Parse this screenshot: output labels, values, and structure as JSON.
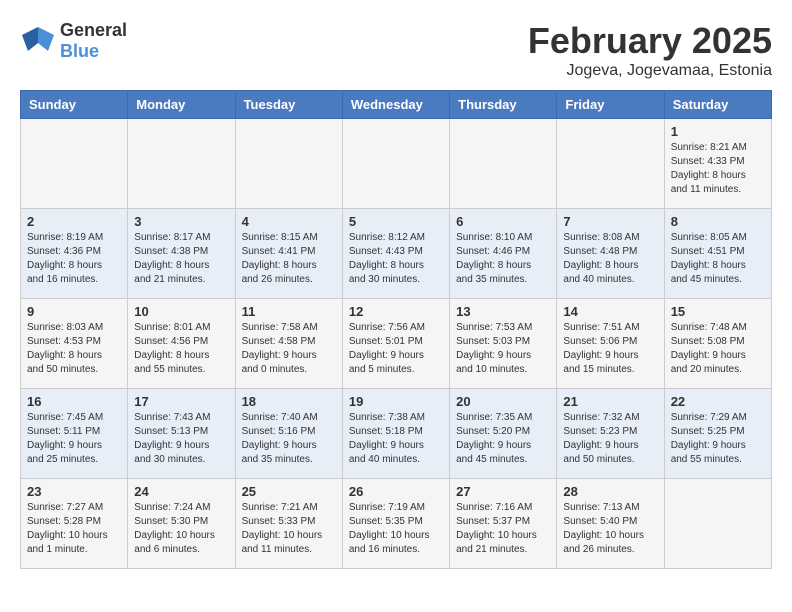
{
  "logo": {
    "general": "General",
    "blue": "Blue"
  },
  "title": "February 2025",
  "subtitle": "Jogeva, Jogevamaa, Estonia",
  "weekdays": [
    "Sunday",
    "Monday",
    "Tuesday",
    "Wednesday",
    "Thursday",
    "Friday",
    "Saturday"
  ],
  "weeks": [
    [
      {
        "day": "",
        "info": ""
      },
      {
        "day": "",
        "info": ""
      },
      {
        "day": "",
        "info": ""
      },
      {
        "day": "",
        "info": ""
      },
      {
        "day": "",
        "info": ""
      },
      {
        "day": "",
        "info": ""
      },
      {
        "day": "1",
        "info": "Sunrise: 8:21 AM\nSunset: 4:33 PM\nDaylight: 8 hours and 11 minutes."
      }
    ],
    [
      {
        "day": "2",
        "info": "Sunrise: 8:19 AM\nSunset: 4:36 PM\nDaylight: 8 hours and 16 minutes."
      },
      {
        "day": "3",
        "info": "Sunrise: 8:17 AM\nSunset: 4:38 PM\nDaylight: 8 hours and 21 minutes."
      },
      {
        "day": "4",
        "info": "Sunrise: 8:15 AM\nSunset: 4:41 PM\nDaylight: 8 hours and 26 minutes."
      },
      {
        "day": "5",
        "info": "Sunrise: 8:12 AM\nSunset: 4:43 PM\nDaylight: 8 hours and 30 minutes."
      },
      {
        "day": "6",
        "info": "Sunrise: 8:10 AM\nSunset: 4:46 PM\nDaylight: 8 hours and 35 minutes."
      },
      {
        "day": "7",
        "info": "Sunrise: 8:08 AM\nSunset: 4:48 PM\nDaylight: 8 hours and 40 minutes."
      },
      {
        "day": "8",
        "info": "Sunrise: 8:05 AM\nSunset: 4:51 PM\nDaylight: 8 hours and 45 minutes."
      }
    ],
    [
      {
        "day": "9",
        "info": "Sunrise: 8:03 AM\nSunset: 4:53 PM\nDaylight: 8 hours and 50 minutes."
      },
      {
        "day": "10",
        "info": "Sunrise: 8:01 AM\nSunset: 4:56 PM\nDaylight: 8 hours and 55 minutes."
      },
      {
        "day": "11",
        "info": "Sunrise: 7:58 AM\nSunset: 4:58 PM\nDaylight: 9 hours and 0 minutes."
      },
      {
        "day": "12",
        "info": "Sunrise: 7:56 AM\nSunset: 5:01 PM\nDaylight: 9 hours and 5 minutes."
      },
      {
        "day": "13",
        "info": "Sunrise: 7:53 AM\nSunset: 5:03 PM\nDaylight: 9 hours and 10 minutes."
      },
      {
        "day": "14",
        "info": "Sunrise: 7:51 AM\nSunset: 5:06 PM\nDaylight: 9 hours and 15 minutes."
      },
      {
        "day": "15",
        "info": "Sunrise: 7:48 AM\nSunset: 5:08 PM\nDaylight: 9 hours and 20 minutes."
      }
    ],
    [
      {
        "day": "16",
        "info": "Sunrise: 7:45 AM\nSunset: 5:11 PM\nDaylight: 9 hours and 25 minutes."
      },
      {
        "day": "17",
        "info": "Sunrise: 7:43 AM\nSunset: 5:13 PM\nDaylight: 9 hours and 30 minutes."
      },
      {
        "day": "18",
        "info": "Sunrise: 7:40 AM\nSunset: 5:16 PM\nDaylight: 9 hours and 35 minutes."
      },
      {
        "day": "19",
        "info": "Sunrise: 7:38 AM\nSunset: 5:18 PM\nDaylight: 9 hours and 40 minutes."
      },
      {
        "day": "20",
        "info": "Sunrise: 7:35 AM\nSunset: 5:20 PM\nDaylight: 9 hours and 45 minutes."
      },
      {
        "day": "21",
        "info": "Sunrise: 7:32 AM\nSunset: 5:23 PM\nDaylight: 9 hours and 50 minutes."
      },
      {
        "day": "22",
        "info": "Sunrise: 7:29 AM\nSunset: 5:25 PM\nDaylight: 9 hours and 55 minutes."
      }
    ],
    [
      {
        "day": "23",
        "info": "Sunrise: 7:27 AM\nSunset: 5:28 PM\nDaylight: 10 hours and 1 minute."
      },
      {
        "day": "24",
        "info": "Sunrise: 7:24 AM\nSunset: 5:30 PM\nDaylight: 10 hours and 6 minutes."
      },
      {
        "day": "25",
        "info": "Sunrise: 7:21 AM\nSunset: 5:33 PM\nDaylight: 10 hours and 11 minutes."
      },
      {
        "day": "26",
        "info": "Sunrise: 7:19 AM\nSunset: 5:35 PM\nDaylight: 10 hours and 16 minutes."
      },
      {
        "day": "27",
        "info": "Sunrise: 7:16 AM\nSunset: 5:37 PM\nDaylight: 10 hours and 21 minutes."
      },
      {
        "day": "28",
        "info": "Sunrise: 7:13 AM\nSunset: 5:40 PM\nDaylight: 10 hours and 26 minutes."
      },
      {
        "day": "",
        "info": ""
      }
    ]
  ]
}
